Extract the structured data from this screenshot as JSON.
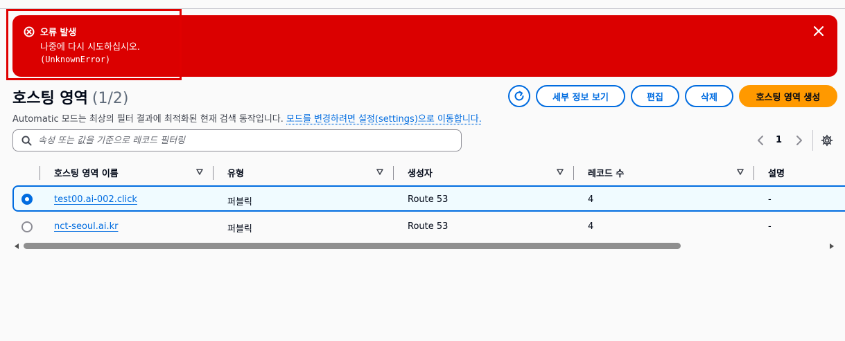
{
  "flash": {
    "title": "오류 발생",
    "message": "나중에 다시 시도하십시오.",
    "code": "(UnknownError)",
    "type": "error",
    "color": "#db0000",
    "icon": "error-circle-icon",
    "close_icon": "close-icon"
  },
  "header": {
    "title": "호스팅 영역",
    "count": "(1/2)",
    "description": "Automatic 모드는 최상의 필터 결과에 최적화된 현재 검색 동작입니다.",
    "description_link": "모드를 변경하려면 설정(settings)으로 이동합니다.",
    "buttons": {
      "details": "세부 정보 보기",
      "edit": "편집",
      "delete": "삭제",
      "create": "호스팅 영역 생성"
    },
    "refresh_icon": "refresh-icon",
    "accent_color": "#006ce0",
    "primary_color": "#ff9900"
  },
  "search": {
    "placeholder": "속성 또는 값을 기준으로 레코드 필터링",
    "value": ""
  },
  "pagination": {
    "current_page": "1"
  },
  "table": {
    "columns": [
      "호스팅 영역 이름",
      "유형",
      "생성자",
      "레코드 수",
      "설명"
    ],
    "rows": [
      {
        "selected": true,
        "name": "test00.ai-002.click",
        "type": "퍼블릭",
        "created_by": "Route 53",
        "record_count": "4",
        "description": "-"
      },
      {
        "selected": false,
        "name": "nct-seoul.ai.kr",
        "type": "퍼블릭",
        "created_by": "Route 53",
        "record_count": "4",
        "description": "-"
      }
    ]
  }
}
